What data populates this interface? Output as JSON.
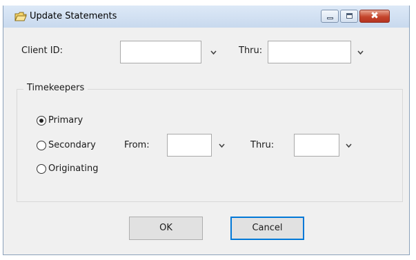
{
  "window": {
    "title": "Update Statements",
    "icon": "folder-icon",
    "controls": {
      "minimize": "minimize-icon",
      "maximize": "maximize-icon",
      "close": "✖"
    }
  },
  "client": {
    "label": "Client ID:",
    "value": "",
    "thru_label": "Thru:",
    "thru_value": ""
  },
  "timekeepers": {
    "legend": "Timekeepers",
    "options": [
      {
        "label": "Primary",
        "checked": true
      },
      {
        "label": "Secondary",
        "checked": false
      },
      {
        "label": "Originating",
        "checked": false
      }
    ],
    "from_label": "From:",
    "from_value": "",
    "thru_label": "Thru:",
    "thru_value": ""
  },
  "buttons": {
    "ok": "OK",
    "cancel": "Cancel"
  },
  "colors": {
    "titlebar": "#c8d9ee",
    "close": "#c4452c",
    "focus": "#0078d7"
  }
}
